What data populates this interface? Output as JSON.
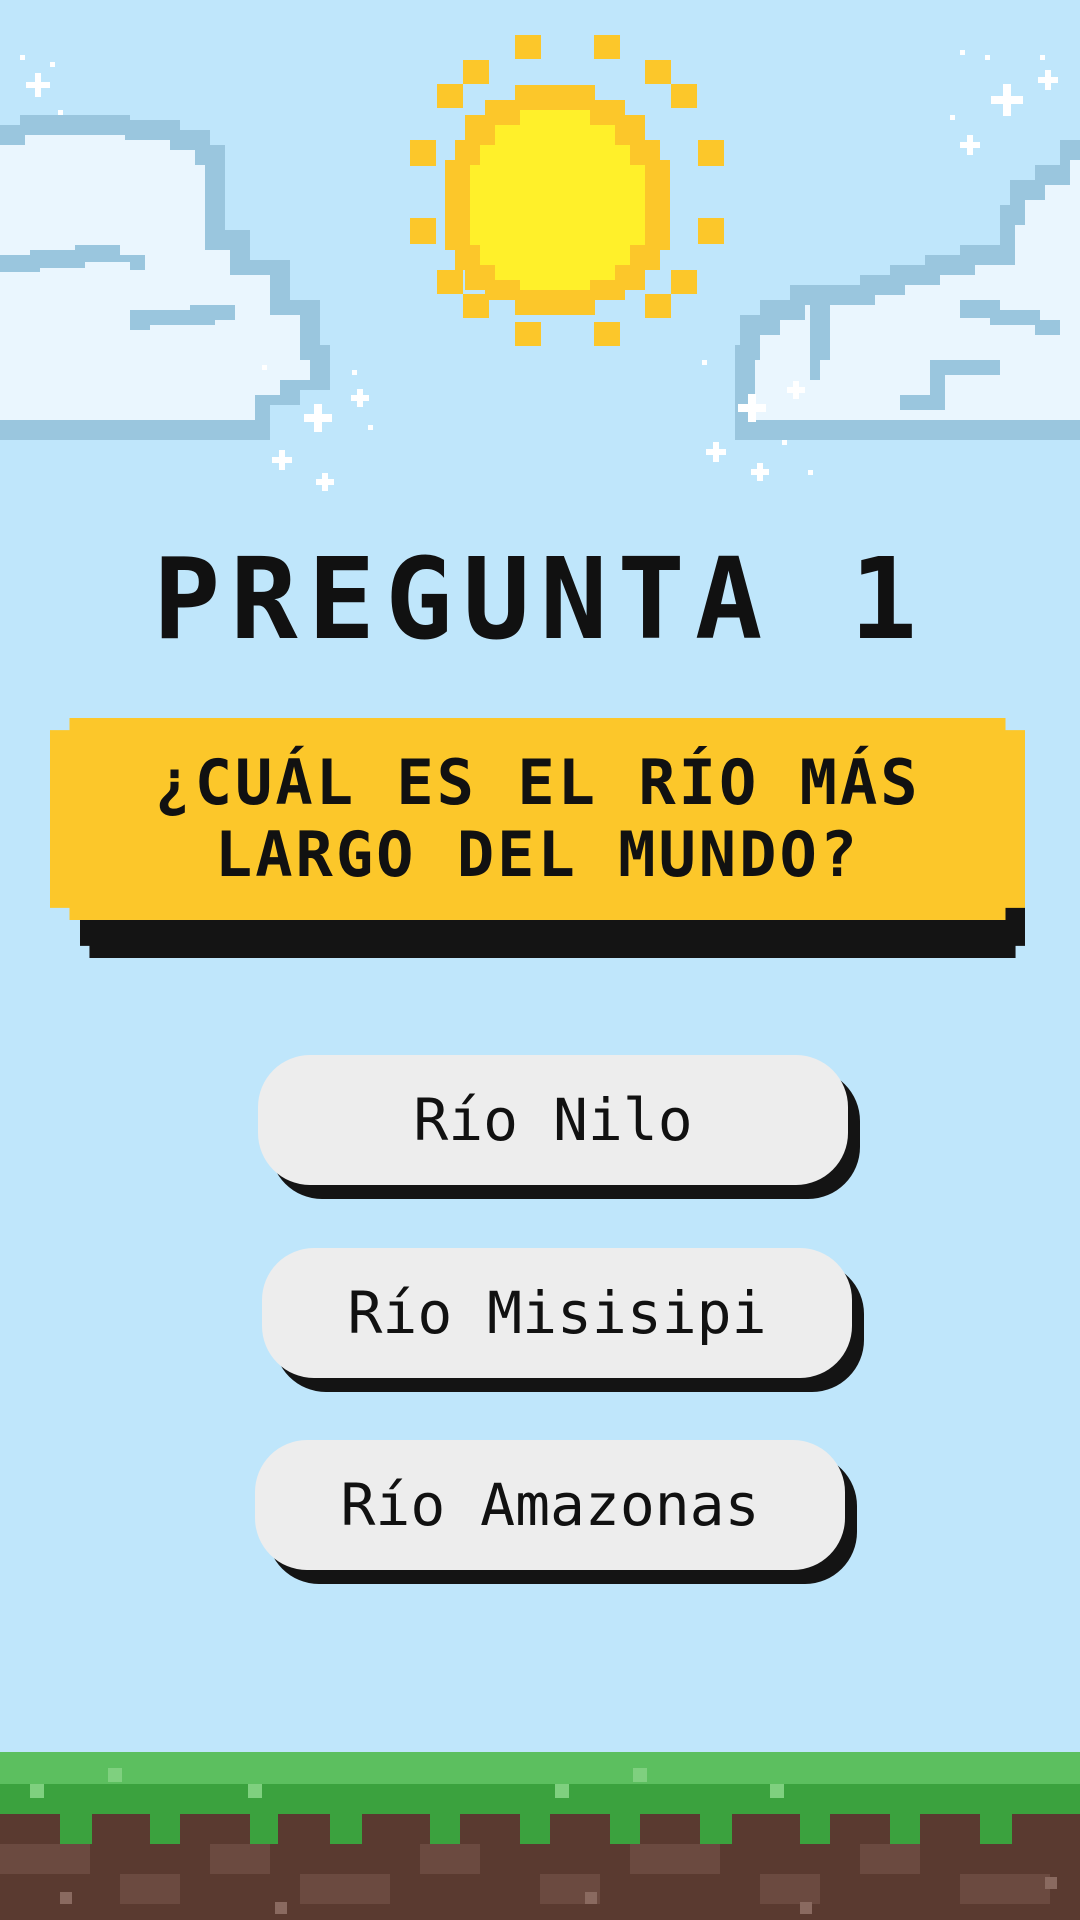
{
  "screen": {
    "title": "PREGUNTA 1",
    "question": "¿CUÁL ES EL RÍO MÁS\nLARGO DEL MUNDO?",
    "answers": [
      {
        "label": "Río Nilo"
      },
      {
        "label": "Río Misisipi"
      },
      {
        "label": "Río Amazonas"
      }
    ]
  },
  "colors": {
    "sky": "#bfe6fb",
    "sun_outer": "#fcc72a",
    "sun_inner": "#fff02a",
    "question_box": "#fcc72a",
    "answer_box": "#ededed",
    "shadow": "#141414",
    "cloud": "#eaf6fe",
    "cloud_outline": "#9ac6de",
    "grass": "#5cbf5f",
    "grass_dark": "#3ba23e",
    "dirt": "#5a3a30"
  },
  "icons": {
    "sun": "sun-icon",
    "clouds": "cloud-icon",
    "sparkles": "sparkle-icon",
    "ground": "grass-ground"
  }
}
